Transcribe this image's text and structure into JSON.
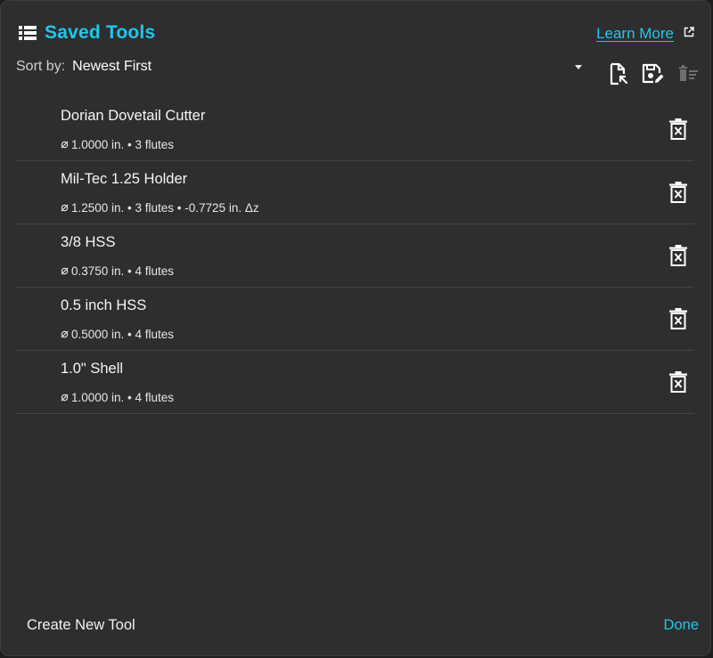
{
  "header": {
    "title": "Saved Tools",
    "title_icon": "list-icon",
    "learn_more": "Learn More",
    "learn_more_icon": "external-link-icon"
  },
  "sort": {
    "label": "Sort by:",
    "selected": "Newest First"
  },
  "toolbar": {
    "icons": [
      "load-file-icon",
      "save-edit-icon",
      "delete-all-icon"
    ]
  },
  "tools": [
    {
      "name": "Dorian Dovetail Cutter",
      "meta": "1.0000 in. • 3 flutes"
    },
    {
      "name": "Mil-Tec 1.25 Holder",
      "meta": "1.2500 in. • 3 flutes • -0.7725 in. Δz"
    },
    {
      "name": "3/8 HSS",
      "meta": "0.3750 in. • 4 flutes"
    },
    {
      "name": "0.5 inch HSS",
      "meta": "0.5000 in. • 4 flutes"
    },
    {
      "name": "1.0\" Shell",
      "meta": "1.0000 in. • 4 flutes"
    }
  ],
  "footer": {
    "create": "Create New Tool",
    "done": "Done"
  },
  "colors": {
    "accent": "#1fc6ee",
    "background": "#2e2e2e",
    "text": "#f0f0f0"
  }
}
